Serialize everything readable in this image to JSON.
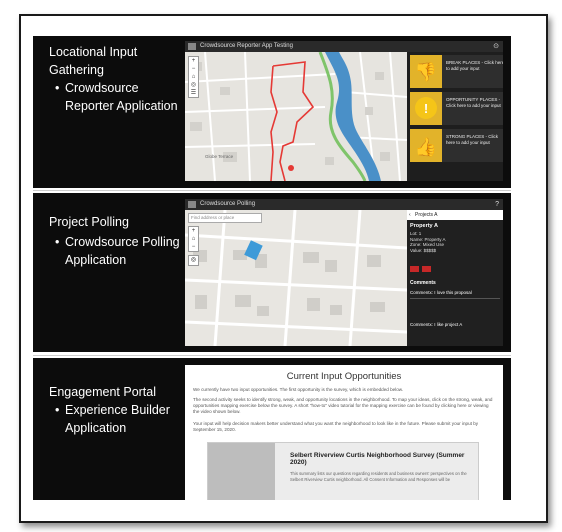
{
  "sections": [
    {
      "title_lines": [
        "Locational Input",
        "Gathering"
      ],
      "bullet_lines": [
        "Crowdsource",
        "Reporter Application"
      ]
    },
    {
      "title_lines": [
        "Project Polling"
      ],
      "bullet_lines": [
        "Crowdsource Polling",
        "Application"
      ]
    },
    {
      "title_lines": [
        "Engagement Portal"
      ],
      "bullet_lines": [
        "Experience Builder",
        "Application"
      ]
    }
  ],
  "bullet_glyph": "•",
  "reporter": {
    "app_title": "Crowdsource Reporter App Testing",
    "cards": [
      {
        "label": "BREAK PLACES - Click here to add your input"
      },
      {
        "label": "OPPORTUNITY PLACES - Click here to add your input"
      },
      {
        "label": "STRONG PLACES - Click here to add your input"
      }
    ],
    "map_label": "Globe Terrace"
  },
  "polling": {
    "app_title": "Crowdsource Polling",
    "search_placeholder": "Find address or place",
    "panel_back": "Projects A",
    "project_name": "Property A",
    "details": [
      "Lot: 1",
      "Name: Property A",
      "Zone: Mixed Use",
      "Value: $$$$$"
    ],
    "comments_header": "Comments",
    "comments": [
      "Commentx: I love this proposal",
      "Commentx: I like project A"
    ]
  },
  "portal": {
    "heading": "Current Input Opportunities",
    "p1": "We currently have two input opportunities. The first opportunity is the survey, which is embedded below.",
    "p2": "The second activity seeks to identify strong, weak, and opportunity locations in the neighborhood. To map your ideas, click on the strong, weak, and opportunities mapping exercise below the survey. A short \"how-to\" video tutorial for the mapping exercise can be found by clicking here or viewing the video shown below.",
    "p3": "Your input will help decision makers better understand what you want the neighborhood to look like in the future. Please submit your input by September 15, 2020.",
    "survey_title": "Selbert Riverview Curtis Neighborhood Survey (Summer 2020)",
    "survey_desc": "This summary lists our questions regarding residents and business owners' perspectives on the Selbert Riverview Curtis neighborhood. All Consent Information and Responses will be"
  },
  "colors": {
    "panel_bg": "#0c0c0c",
    "accent_yellow": "#e2b32a",
    "river": "#4a90c8",
    "boundary": "#e53935",
    "parcel": "#3d9ad8"
  }
}
